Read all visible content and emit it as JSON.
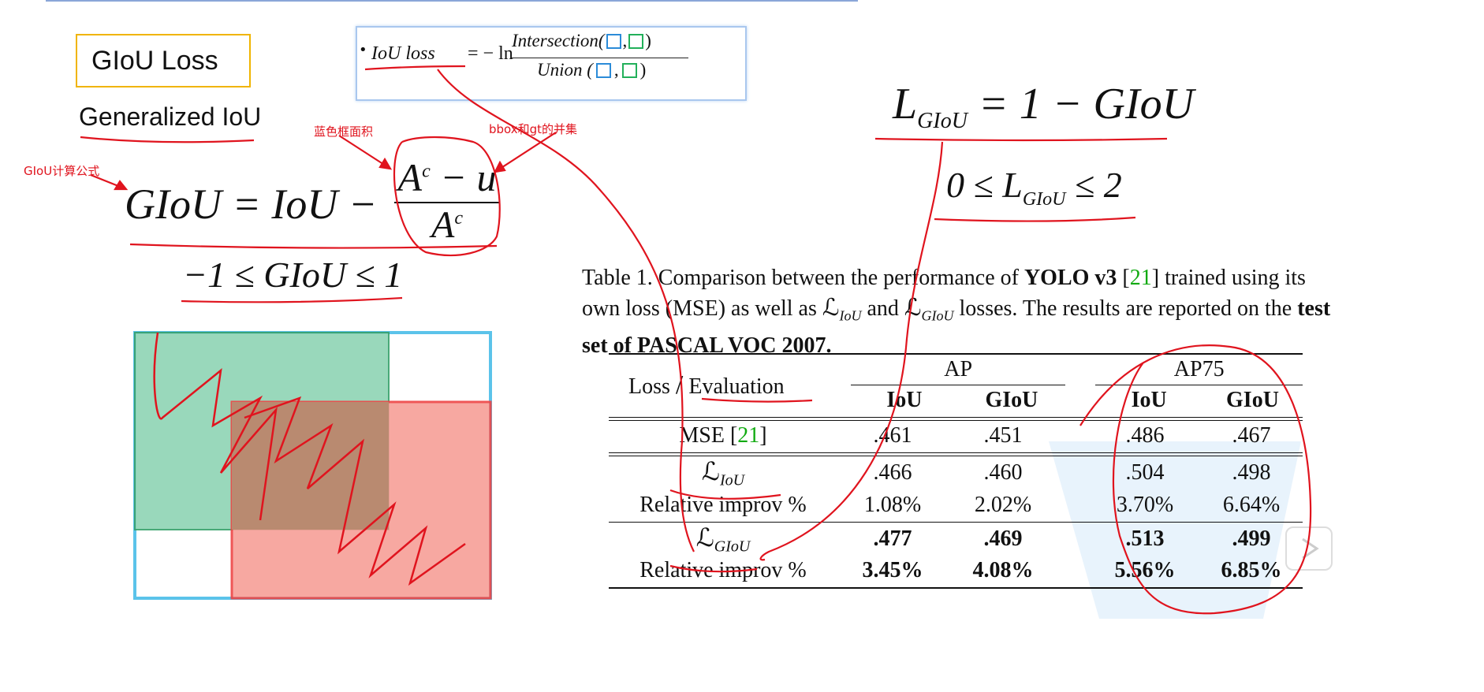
{
  "slide": {
    "title": "GIoU Loss",
    "subtitle": "Generalized IoU"
  },
  "iou_loss_box": {
    "bullet": "•",
    "lhs": "IoU loss",
    "eq": "= − ln",
    "numerator": "Intersection(",
    "denominator": "Union (",
    "comma": ",",
    "close": ")"
  },
  "giou_formula": {
    "lhs": "GIoU = IoU −",
    "numerator": "A",
    "numerator_sup": "c",
    "numerator_rest": " − u",
    "denominator": "A",
    "denominator_sup": "c",
    "range": "−1 ≤ GIoU ≤ 1"
  },
  "loss_formula": {
    "L": "L",
    "sub": "GIoU",
    "rest": " = 1 − GIoU",
    "range_left": "0 ≤ L",
    "range_sub": "GIoU",
    "range_right": " ≤ 2"
  },
  "annotations": {
    "formula_note": "GIoU计算公式",
    "blue_area_note": "蓝色框面积",
    "union_note": "bbox和gt的并集"
  },
  "colors": {
    "blue_box": "#5bc3ea",
    "green_box_fill": "#8fd4b4",
    "red_box_fill": "#f79f97",
    "overlap_fill": "#b98a70",
    "annotation_red": "#e0141e",
    "citation_green": "#11aa11"
  },
  "caption": {
    "p1": "Table 1. Comparison between the performance of ",
    "b1": "YOLO v3",
    "p2": " [",
    "cite": "21",
    "p3": "] trained using its own loss (MSE) as well as ",
    "l1": "ℒ",
    "l1_sub": "IoU",
    "p4": " and ",
    "l2": "ℒ",
    "l2_sub": "GIoU",
    "p5": " losses. The results are reported on the ",
    "b2": "test set of PASCAL VOC 2007."
  },
  "table": {
    "corner_loss": "Loss",
    "corner_slash": "/",
    "corner_eval": "Evaluation",
    "group_ap": "AP",
    "group_ap75": "AP75",
    "sub_headers": [
      "IoU",
      "GIoU",
      "IoU",
      "GIoU"
    ],
    "mse_label": "MSE [",
    "mse_cite": "21",
    "mse_close": "]",
    "mse_values": [
      ".461",
      ".451",
      ".486",
      ".467"
    ],
    "liou_label": "ℒ",
    "liou_sub": "IoU",
    "liou_values": [
      ".466",
      ".460",
      ".504",
      ".498"
    ],
    "rel1_label": "Relative improv %",
    "rel1_values": [
      "1.08%",
      "2.02%",
      "3.70%",
      "6.64%"
    ],
    "lgiou_label": "ℒ",
    "lgiou_sub": "GIoU",
    "lgiou_values": [
      ".477",
      ".469",
      ".513",
      ".499"
    ],
    "rel2_label": "Relative improv %",
    "rel2_values": [
      "3.45%",
      "4.08%",
      "5.56%",
      "6.85%"
    ]
  }
}
